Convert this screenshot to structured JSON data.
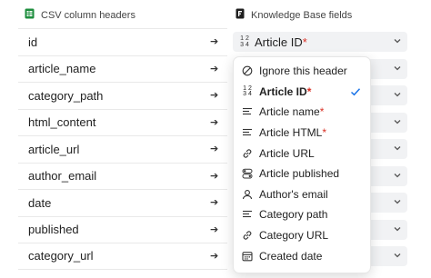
{
  "header": {
    "left_label": "CSV column headers",
    "right_label": "Knowledge Base fields"
  },
  "rows": [
    {
      "csv": "id",
      "mapped": "Article ID"
    },
    {
      "csv": "article_name"
    },
    {
      "csv": "category_path"
    },
    {
      "csv": "html_content"
    },
    {
      "csv": "article_url"
    },
    {
      "csv": "author_email"
    },
    {
      "csv": "date"
    },
    {
      "csv": "published"
    },
    {
      "csv": "category_url"
    }
  ],
  "required_marker": "*",
  "dropdown": {
    "selected": "Article ID",
    "options": [
      {
        "label": "Ignore this header",
        "icon": "ignore-icon"
      },
      {
        "label": "Article ID",
        "icon": "number-icon",
        "required": true
      },
      {
        "label": "Article name",
        "icon": "text-lines-icon",
        "required": true
      },
      {
        "label": "Article HTML",
        "icon": "text-lines-icon",
        "required": true
      },
      {
        "label": "Article URL",
        "icon": "link-icon"
      },
      {
        "label": "Article published",
        "icon": "toggle-icon"
      },
      {
        "label": "Author's email",
        "icon": "person-icon"
      },
      {
        "label": "Category path",
        "icon": "text-lines-icon"
      },
      {
        "label": "Category URL",
        "icon": "link-icon"
      },
      {
        "label": "Created date",
        "icon": "calendar-icon"
      }
    ]
  },
  "colors": {
    "sheets_green": "#1e8e3e",
    "required_red": "#d93025",
    "check_blue": "#1a73e8"
  }
}
